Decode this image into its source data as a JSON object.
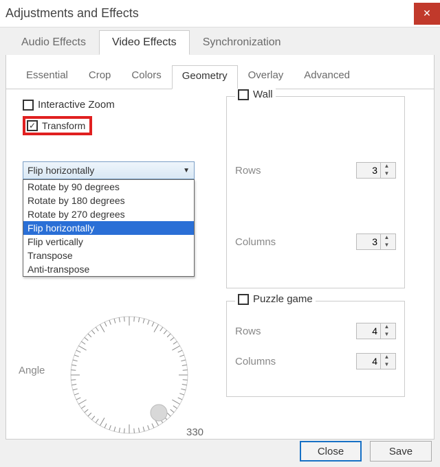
{
  "window": {
    "title": "Adjustments and Effects"
  },
  "mainTabs": [
    "Audio Effects",
    "Video Effects",
    "Synchronization"
  ],
  "activeMainTab": 1,
  "subTabs": [
    "Essential",
    "Crop",
    "Colors",
    "Geometry",
    "Overlay",
    "Advanced"
  ],
  "activeSubTab": 3,
  "interactiveZoom": {
    "label": "Interactive Zoom",
    "checked": false
  },
  "transform": {
    "label": "Transform",
    "checked": true,
    "selected": "Flip horizontally",
    "options": [
      "Rotate by 90 degrees",
      "Rotate by 180 degrees",
      "Rotate by 270 degrees",
      "Flip horizontally",
      "Flip vertically",
      "Transpose",
      "Anti-transpose"
    ],
    "highlightedIndex": 3
  },
  "angle": {
    "label": "Angle",
    "value": 330
  },
  "wall": {
    "label": "Wall",
    "checked": false,
    "rowsLabel": "Rows",
    "rows": 3,
    "colsLabel": "Columns",
    "cols": 3
  },
  "puzzle": {
    "label": "Puzzle game",
    "checked": false,
    "rowsLabel": "Rows",
    "rows": 4,
    "colsLabel": "Columns",
    "cols": 4
  },
  "buttons": {
    "close": "Close",
    "save": "Save"
  }
}
